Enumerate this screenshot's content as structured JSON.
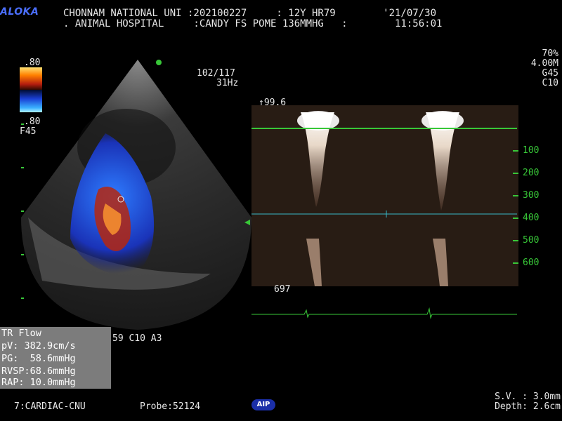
{
  "header": {
    "logo": "ALOKA",
    "line1": "CHONNAM NATIONAL UNI :202100227     : 12Y HR79        '21/07/30",
    "line2": ". ANIMAL HOSPITAL     :CANDY FS POME 136MMHG   :        11:56:01"
  },
  "color_scale": {
    "top_value": ".80",
    "bottom_value": ".80",
    "freq_label": "F45"
  },
  "image_info": {
    "frame": "102/117",
    "rate": "31Hz"
  },
  "doppler_settings": {
    "power": "70%",
    "depth": "4.00M",
    "gain": "G45",
    "curve": "C10"
  },
  "doppler": {
    "top_label": "↑99.6",
    "bottom_label": "697",
    "scale_ticks": [
      "100",
      "200",
      "300",
      "400",
      "500",
      "600"
    ]
  },
  "probe_params": "59 C10 A3",
  "measurement": {
    "title": "TR Flow",
    "rows": [
      {
        "label": "pV:",
        "value": " 382.9cm/s"
      },
      {
        "label": "PG:",
        "value": "  58.6mmHg"
      },
      {
        "label": "RVSP:",
        "value": "68.6mmHg"
      },
      {
        "label": "RAP:",
        "value": " 10.0mmHg"
      }
    ]
  },
  "footer": {
    "preset": "7:CARDIAC-CNU",
    "probe": "Probe:52124",
    "aip_badge": "AIP",
    "sample_volume": "S.V. : 3.0mm",
    "depth": "Depth: 2.6cm"
  },
  "colors": {
    "accent_green": "#38c738",
    "baseline_cyan": "#38b8c8",
    "logo_blue": "#4b6fff"
  }
}
